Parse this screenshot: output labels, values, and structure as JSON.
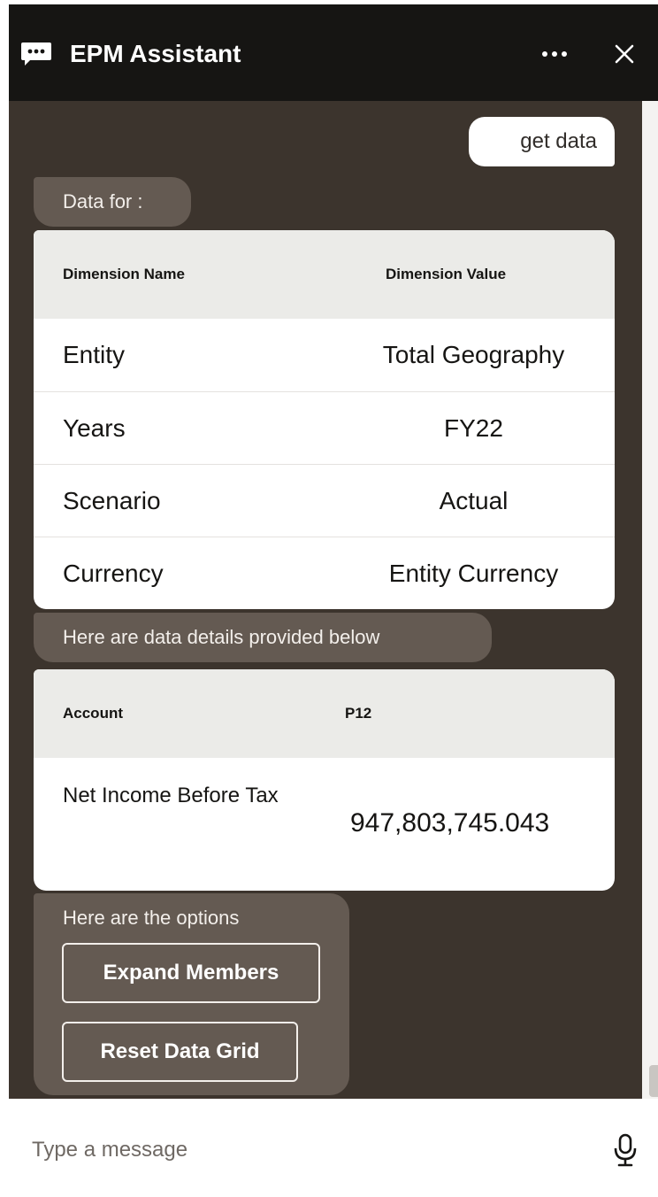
{
  "header": {
    "title": "EPM Assistant",
    "icons": {
      "chat": "chat-bubble-icon",
      "more": "ellipsis-icon",
      "close": "close-icon"
    },
    "background": "#161513"
  },
  "conversation": {
    "background": "#3c342d",
    "user_message": "get data",
    "bot_intro": "Data for :",
    "dimension_table": {
      "columns": [
        "Dimension Name",
        "Dimension Value"
      ],
      "rows": [
        [
          "Entity",
          "Total Geography"
        ],
        [
          "Years",
          "FY22"
        ],
        [
          "Scenario",
          "Actual"
        ],
        [
          "Currency",
          "Entity Currency"
        ]
      ]
    },
    "details_intro": "Here are data details provided below",
    "data_table": {
      "columns": [
        "Account",
        "P12"
      ],
      "rows": [
        [
          "Net Income Before Tax",
          "947,803,745.043"
        ]
      ]
    },
    "options_label": "Here are the options",
    "options": [
      "Expand Members",
      "Reset Data Grid"
    ]
  },
  "input": {
    "placeholder": "Type a message",
    "icon": "microphone-icon"
  }
}
